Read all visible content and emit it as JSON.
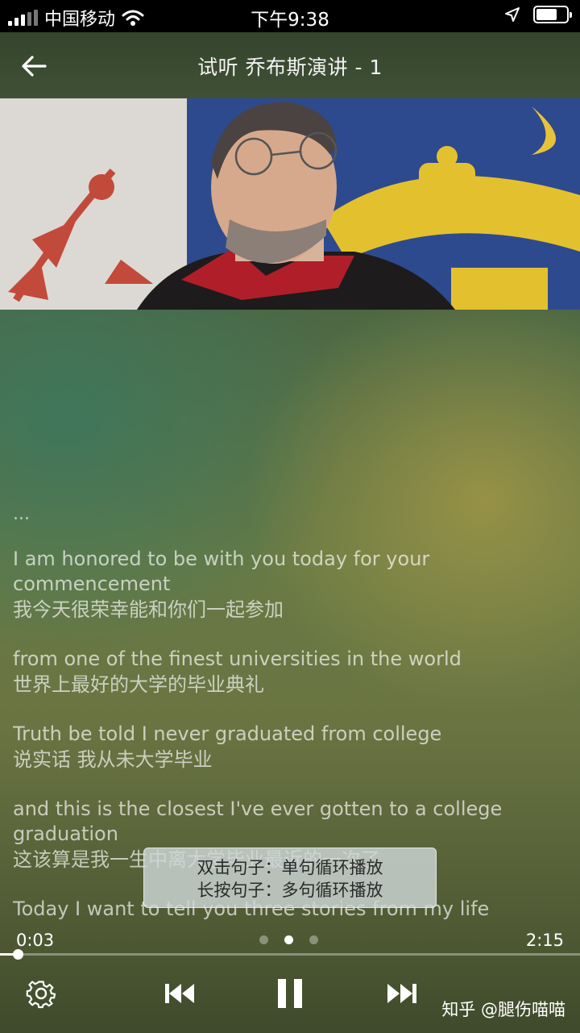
{
  "status_bar": {
    "carrier": "中国移动",
    "time": "下午9:38"
  },
  "nav": {
    "title": "试听 乔布斯演讲 - 1"
  },
  "transcript": {
    "leading": "...",
    "sentences": [
      {
        "en": "I am honored to be with you today for your commencement",
        "zh": "我今天很荣幸能和你们一起参加"
      },
      {
        "en": "from one of the finest universities in the world",
        "zh": "世界上最好的大学的毕业典礼"
      },
      {
        "en": "Truth be told I never graduated from college",
        "zh": "说实话 我从未大学毕业"
      },
      {
        "en": "and this is the closest I've ever gotten to a college graduation",
        "zh": "这该算是我一生中离大学毕业最近的一次了"
      },
      {
        "en": "Today I want to tell you three stories from my life",
        "zh": ""
      }
    ]
  },
  "tip": {
    "line1": "双击句子：单句循环播放",
    "line2": "长按句子：多句循环播放"
  },
  "player": {
    "current_time": "0:03",
    "total_time": "2:15",
    "progress": 0.03,
    "page_count": 3,
    "active_page": 2
  },
  "watermark": "知乎 @腿伤喵喵",
  "icons": {
    "back": "arrow-left-icon",
    "settings": "gear-icon",
    "previous": "skip-previous-icon",
    "pause": "pause-icon",
    "next": "skip-next-icon"
  }
}
